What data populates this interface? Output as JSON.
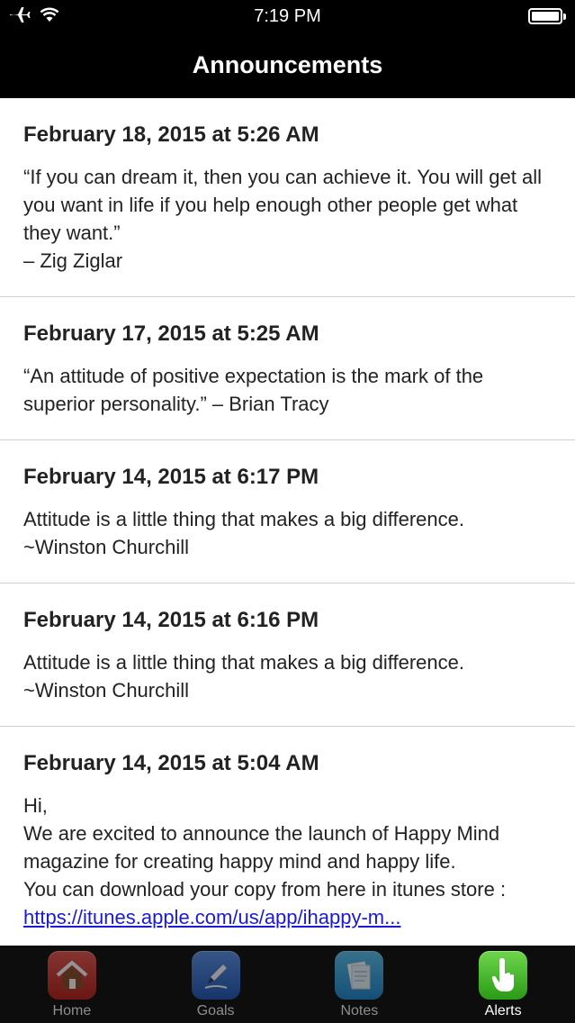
{
  "status_bar": {
    "time": "7:19 PM",
    "icons": [
      "airplane-icon",
      "wifi-icon",
      "battery-icon"
    ]
  },
  "nav": {
    "title": "Announcements"
  },
  "announcements": [
    {
      "date": "February 18, 2015 at 5:26 AM",
      "body": "“If you can dream it, then you can achieve it. You will get all you want in life if you help enough other people get what they want.”\n– Zig Ziglar"
    },
    {
      "date": "February 17, 2015 at 5:25 AM",
      "body": "“An attitude of positive expectation is the mark of the superior personality.” – Brian Tracy"
    },
    {
      "date": "February 14, 2015 at 6:17 PM",
      "body": "Attitude is a little thing that makes a big difference.\n~Winston Churchill"
    },
    {
      "date": "February 14, 2015 at 6:16 PM",
      "body": "Attitude is a little thing that makes a big difference.\n~Winston Churchill"
    },
    {
      "date": "February 14, 2015 at 5:04 AM",
      "body": "Hi,\nWe are excited to announce the launch of Happy Mind magazine for creating happy mind and happy life.\nYou can download your copy from here in itunes store :",
      "link": "https://itunes.apple.com/us/app/ihappy-m..."
    }
  ],
  "tabs": [
    {
      "label": "Home",
      "icon": "home-icon",
      "color": "#d9302c",
      "active": false
    },
    {
      "label": "Goals",
      "icon": "pen-icon",
      "color": "#2f6fd6",
      "active": false
    },
    {
      "label": "Notes",
      "icon": "notes-icon",
      "color": "#2aa3e6",
      "active": false
    },
    {
      "label": "Alerts",
      "icon": "hand-pointer-icon",
      "color": "#3cb324",
      "active": true
    }
  ]
}
